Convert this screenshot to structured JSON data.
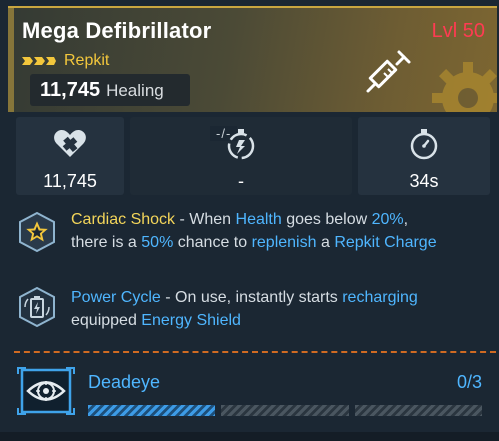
{
  "item": {
    "name": "Mega Defibrillator",
    "level": "Lvl 50",
    "rarity": "Repkit",
    "stat_value": "11,745",
    "stat_unit": "Healing"
  },
  "stats": [
    {
      "icon": "heart-heal-icon",
      "value": "11,745"
    },
    {
      "icon": "recharge-timer-icon",
      "value": "-",
      "tag": "-/-"
    },
    {
      "icon": "stopwatch-icon",
      "value": "34s"
    }
  ],
  "perks": [
    {
      "icon": "star-badge-icon",
      "name": "Cardiac Shock",
      "sep": " - ",
      "t1": "When ",
      "b1": "Health",
      "t2": " goes below ",
      "b2": "20%",
      "t3": ",",
      "t4": "there is a ",
      "b3": "50%",
      "t5": " chance to ",
      "b4": "replenish",
      "t6": " a ",
      "b5": "Repkit Charge"
    },
    {
      "icon": "battery-shield-icon",
      "name": "Power Cycle",
      "sep": " - ",
      "t1": "On use, instantly starts ",
      "b1": "recharging",
      "t2": "equipped ",
      "b2": "Energy Shield"
    }
  ],
  "skill": {
    "icon": "eye-target-icon",
    "name": "Deadeye",
    "progress": "0/3",
    "filled_segments": 1,
    "total_segments": 3
  },
  "colors": {
    "level": "#ff3b52",
    "rarity": "#f3c73c",
    "highlight_gold": "#f3d55a",
    "highlight_blue": "#4fb6ff",
    "divider": "#d06a22"
  }
}
